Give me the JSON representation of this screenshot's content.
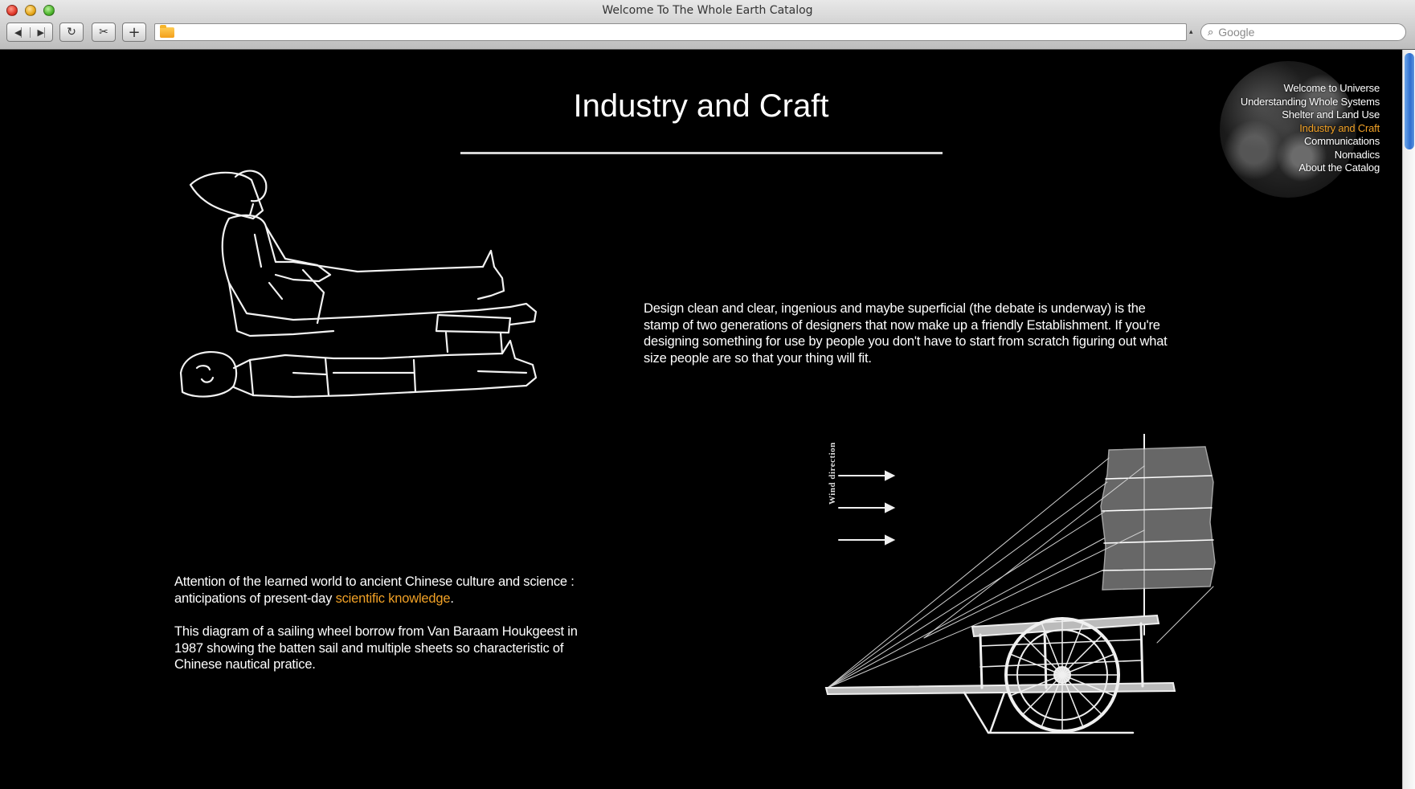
{
  "window": {
    "title": "Welcome To The Whole Earth Catalog"
  },
  "toolbar": {
    "back_glyph": "◀",
    "forward_glyph": "▶",
    "reload_glyph": "↻",
    "snip_glyph": "✂",
    "add_glyph": "+",
    "url_value": "",
    "search_placeholder": "Google",
    "search_glyph": "🔍︎"
  },
  "page": {
    "title": "Industry and Craft",
    "design_text": "Design clean and clear, ingenious and maybe superficial (the debate is underway) is the stamp of two generations of designers that now make up a friendly Establishment. If you're designing something for use by people you don't have to start from scratch figuring out what size people are so that your thing will fit.",
    "attention_text_before": "Attention of the learned world to ancient Chinese culture and science : anticipations of present-day ",
    "attention_link": "scientific knowledge",
    "attention_text_after": ".",
    "diagram_text": "This diagram of a sailing wheel borrow from Van Baraam Houkgeest in 1987 showing the batten sail and multiple sheets so characteristic of Chinese nautical pratice.",
    "wind_label": "Wind direction"
  },
  "nav": {
    "items": [
      {
        "label": "Welcome to Universe",
        "active": false
      },
      {
        "label": "Understanding Whole Systems",
        "active": false
      },
      {
        "label": "Shelter and Land Use",
        "active": false
      },
      {
        "label": "Industry and Craft",
        "active": true
      },
      {
        "label": "Communications",
        "active": false
      },
      {
        "label": "Nomadics",
        "active": false
      },
      {
        "label": "About the Catalog",
        "active": false
      }
    ],
    "active_color": "#f1a126"
  },
  "colors": {
    "background": "#000000",
    "text": "#ffffff",
    "accent": "#f1a126"
  }
}
